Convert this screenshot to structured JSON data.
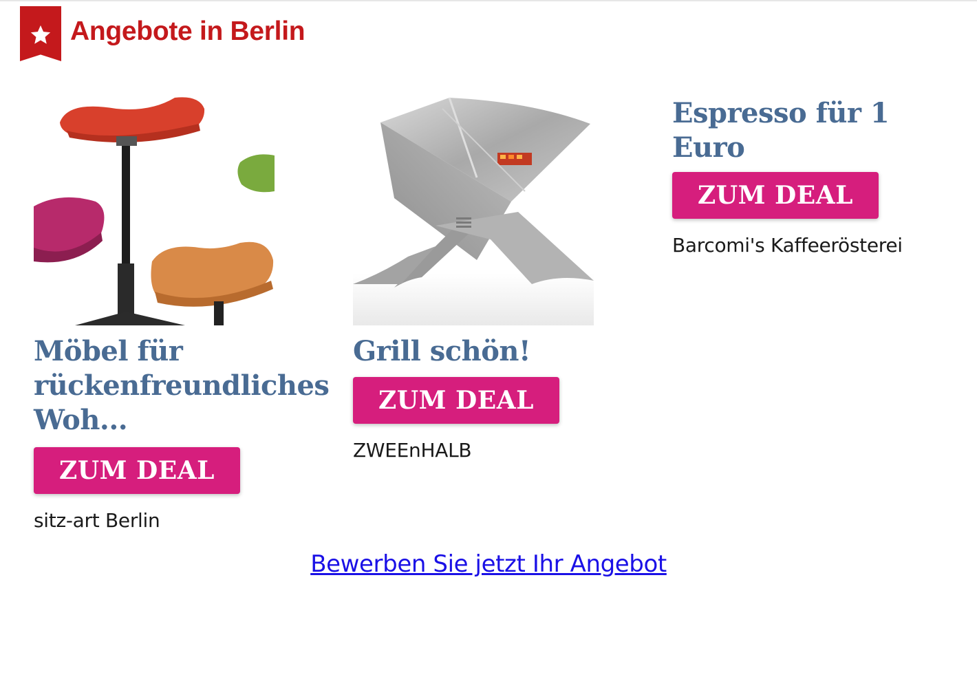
{
  "header": {
    "title": "Angebote in Berlin",
    "icon": "star-icon",
    "color": "#c4191c"
  },
  "deals": [
    {
      "title": "Möbel für rückenfreundliches Woh...",
      "button_label": "ZUM DEAL",
      "merchant": "sitz-art Berlin",
      "image": "colorful-saddle-stools"
    },
    {
      "title": "Grill schön!",
      "button_label": "ZUM DEAL",
      "merchant": "ZWEEnHALB",
      "image": "steel-fire-grill"
    },
    {
      "title": "Espresso für 1 Euro",
      "button_label": "ZUM DEAL",
      "merchant": "Barcomi's Kaffeerösterei"
    }
  ],
  "cta": {
    "label": "Bewerben Sie jetzt Ihr Angebot"
  },
  "colors": {
    "title": "#496b93",
    "button": "#d61e7d",
    "link": "#1a10e6"
  }
}
